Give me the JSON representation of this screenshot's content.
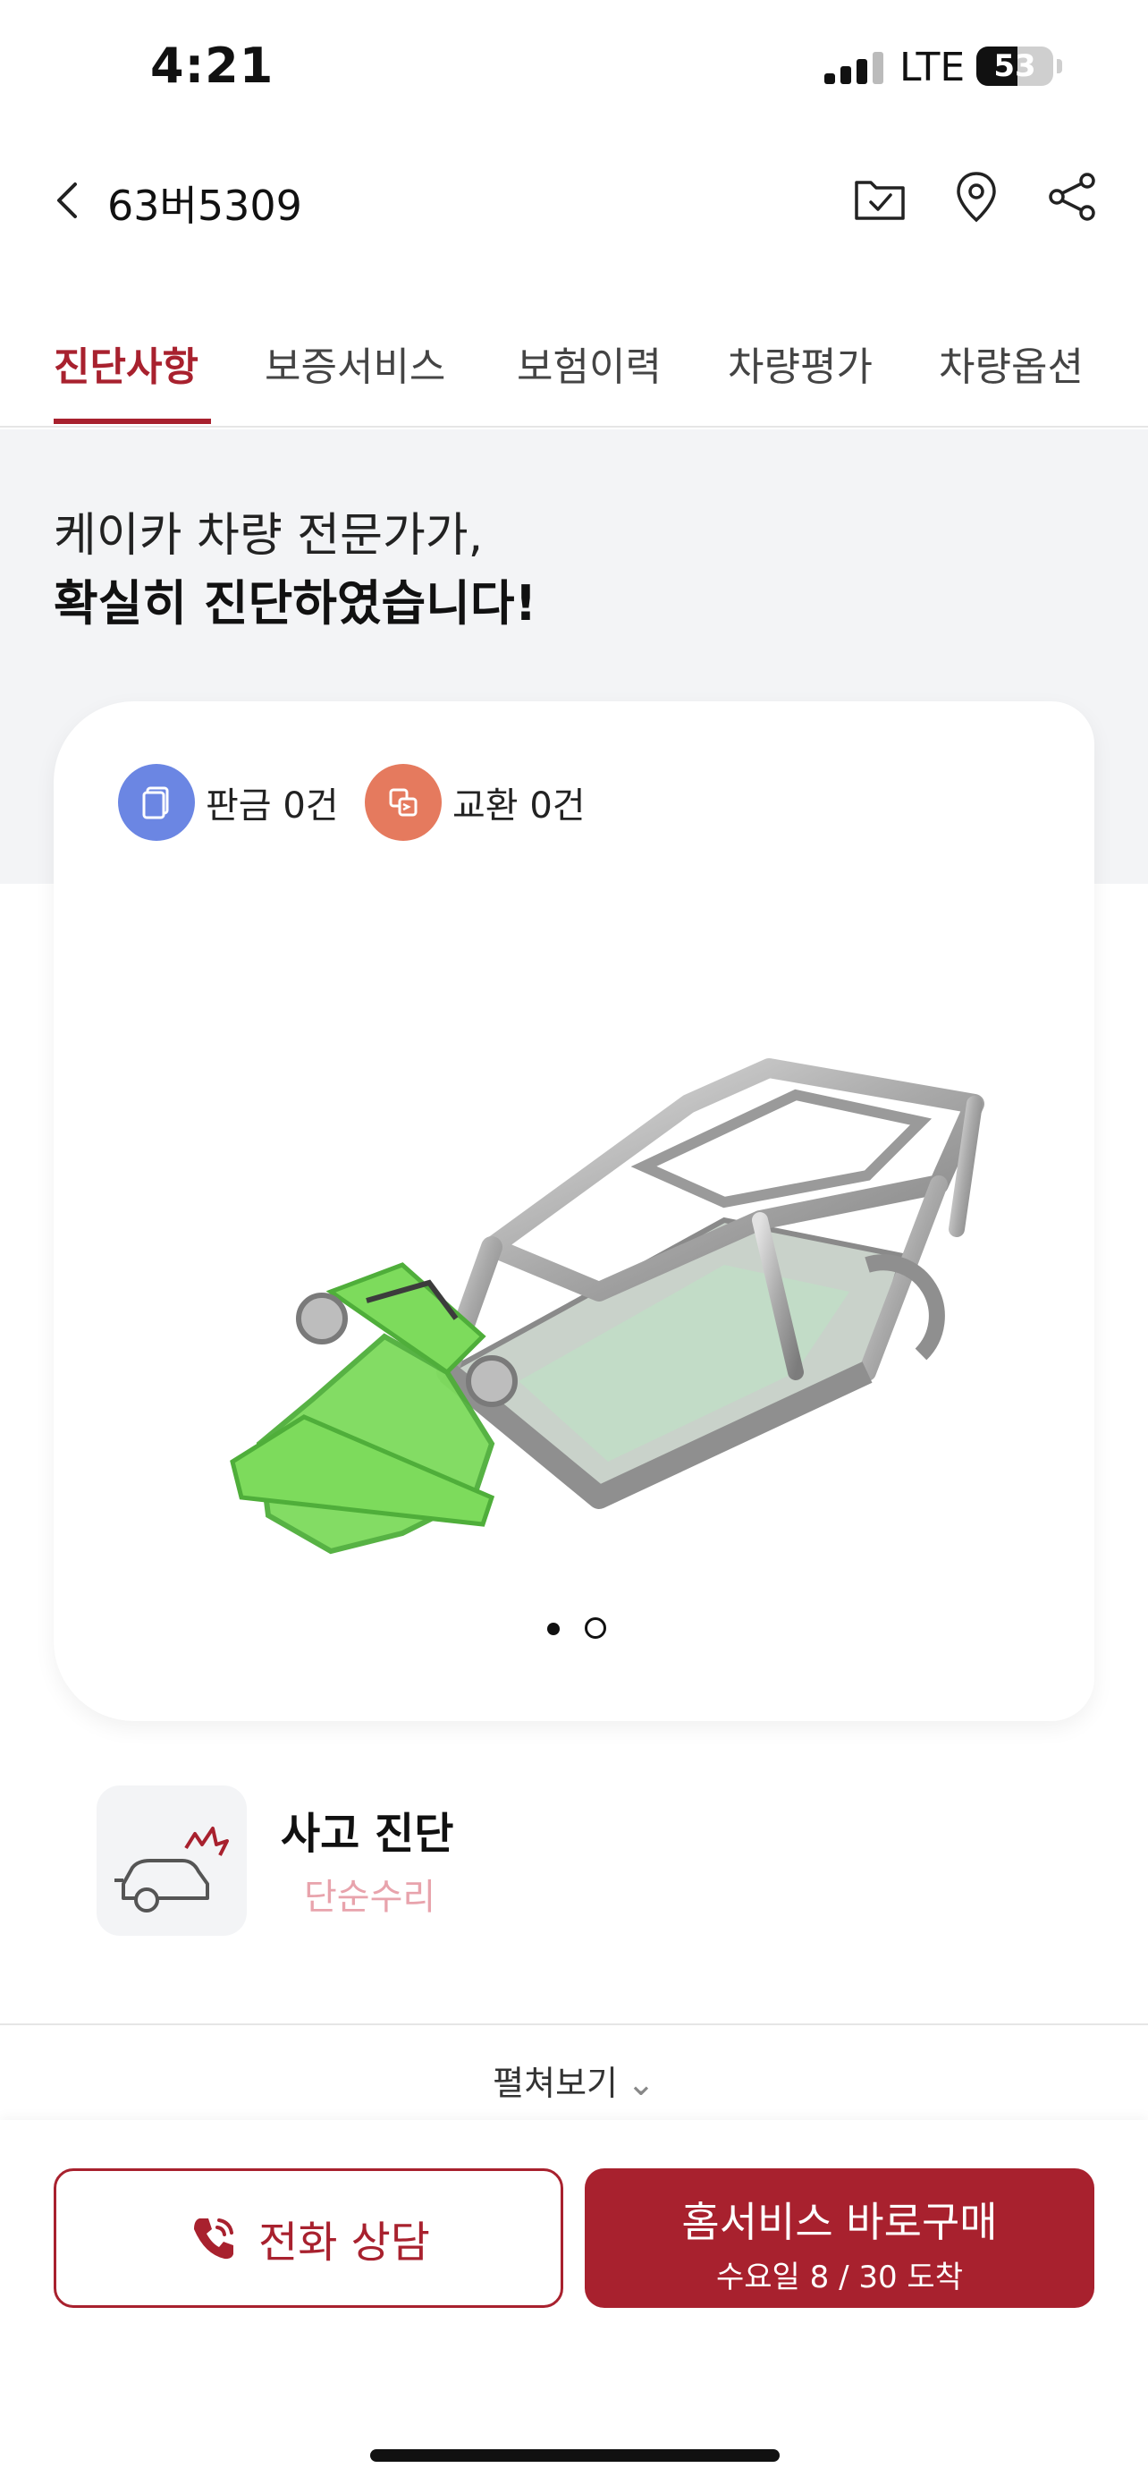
{
  "status_bar": {
    "time": "4:21",
    "network": "LTE",
    "battery": "53",
    "battery_level": 0.53
  },
  "header": {
    "title": "63버5309",
    "icons": [
      "folder-check-icon",
      "map-pin-icon",
      "share-icon"
    ]
  },
  "tabs": [
    {
      "label": "진단사항",
      "active": true
    },
    {
      "label": "보증서비스",
      "active": false
    },
    {
      "label": "보험이력",
      "active": false
    },
    {
      "label": "차량평가",
      "active": false
    },
    {
      "label": "차량옵션",
      "active": false
    }
  ],
  "intro": {
    "line1": "케이카 차량 전문가가,",
    "line2": "확실히 진단하였습니다!"
  },
  "diagnosis_card": {
    "legend": [
      {
        "label": "판금 0건",
        "color": "#6b86e3",
        "icon": "panel-icon"
      },
      {
        "label": "교환 0건",
        "color": "#e57a5e",
        "icon": "exchange-icon"
      }
    ],
    "highlight_color": "#7ddb5c",
    "pagination": {
      "current": 1,
      "total": 2
    }
  },
  "accident": {
    "title": "사고 진단",
    "status": "단순수리",
    "icon": "car-crash-icon"
  },
  "expand_label": "펼쳐보기",
  "bottom_bar": {
    "call_label": "전화 상담",
    "buy_label": "홈서비스 바로구매",
    "buy_sub": "수요일 8 / 30 도착"
  },
  "colors": {
    "brand": "#a8212e",
    "background_grey": "#f3f4f6"
  }
}
